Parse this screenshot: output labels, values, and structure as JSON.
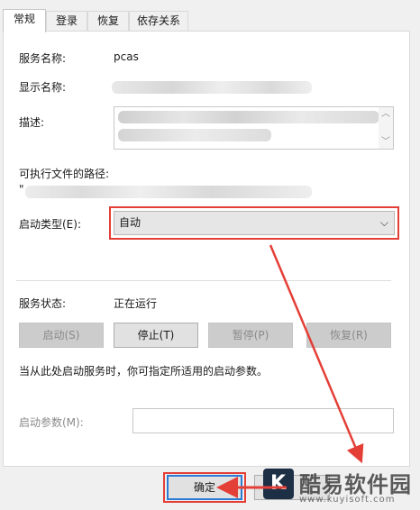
{
  "tabs": [
    {
      "label": "常规",
      "active": true
    },
    {
      "label": "登录",
      "active": false
    },
    {
      "label": "恢复",
      "active": false
    },
    {
      "label": "依存关系",
      "active": false
    }
  ],
  "fields": {
    "service_name_label": "服务名称:",
    "service_name_value": "pcas",
    "display_name_label": "显示名称:",
    "description_label": "描述:",
    "exe_path_label": "可执行文件的路径:",
    "exe_path_value_prefix": "\"",
    "startup_type_label": "启动类型(E):",
    "startup_type_value": "自动"
  },
  "status": {
    "label": "服务状态:",
    "value": "正在运行"
  },
  "buttons": {
    "start": "启动(S)",
    "stop": "停止(T)",
    "pause": "暂停(P)",
    "resume": "恢复(R)",
    "ok": "确定"
  },
  "hint": "当从此处启动服务时，你可指定所适用的启动参数。",
  "start_params_label": "启动参数(M):",
  "watermark": {
    "logo_letter": "K",
    "text": "酷易软件园",
    "subtext": "www.kuyisoft.com"
  },
  "colors": {
    "highlight_red": "#e43f37",
    "focus_blue": "#2b7bd6",
    "panel_bg": "#ffffff",
    "window_bg": "#f0f0f0"
  }
}
